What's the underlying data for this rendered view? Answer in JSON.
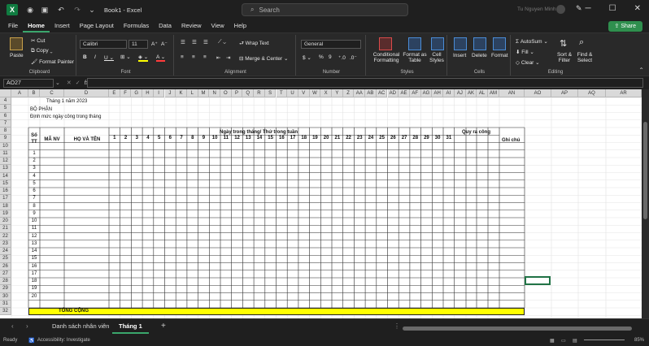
{
  "window": {
    "doc_title": "Book1 - Excel",
    "search_placeholder": "Search",
    "user": "Tu Nguyen Minh"
  },
  "menu": {
    "tabs": [
      "File",
      "Home",
      "Insert",
      "Page Layout",
      "Formulas",
      "Data",
      "Review",
      "View",
      "Help"
    ],
    "active": "Home",
    "share_label": "Share"
  },
  "ribbon": {
    "clipboard": {
      "paste": "Paste",
      "cut": "Cut",
      "copy": "Copy",
      "format_painter": "Format Painter",
      "label": "Clipboard"
    },
    "font": {
      "name": "Calibri",
      "size": "11",
      "label": "Font"
    },
    "alignment": {
      "wrap": "Wrap Text",
      "merge": "Merge & Center",
      "label": "Alignment"
    },
    "number": {
      "format": "General",
      "label": "Number"
    },
    "styles": {
      "conditional": "Conditional Formatting",
      "format_table": "Format as Table",
      "cell_styles": "Cell Styles",
      "label": "Styles"
    },
    "cells": {
      "insert": "Insert",
      "delete": "Delete",
      "format": "Format",
      "label": "Cells"
    },
    "editing": {
      "autosum": "AutoSum",
      "fill": "Fill",
      "clear": "Clear",
      "sort": "Sort & Filter",
      "find": "Find & Select",
      "label": "Editing"
    }
  },
  "formula_bar": {
    "name_box": "AO27",
    "fx": "fx",
    "formula": ""
  },
  "columns": [
    "A",
    "B",
    "C",
    "D",
    "E",
    "F",
    "G",
    "H",
    "I",
    "J",
    "K",
    "L",
    "M",
    "N",
    "O",
    "P",
    "Q",
    "R",
    "S",
    "T",
    "U",
    "V",
    "W",
    "X",
    "Y",
    "Z",
    "AA",
    "AB",
    "AC",
    "AD",
    "AE",
    "AF",
    "AG",
    "AH",
    "AI",
    "AJ",
    "AK",
    "AL",
    "AM",
    "AN",
    "AO",
    "AP",
    "AQ",
    "AR"
  ],
  "sheet": {
    "title_row": "Tháng 1 năm 2023",
    "dept_label": "BỘ PHẬN",
    "norm_label": "Định mức ngày công trong tháng",
    "hdr_stt": "Số TT",
    "hdr_manv": "MÃ NV",
    "hdr_hoten": "HỌ VÀ TÊN",
    "hdr_days": "Ngày trong tháng/ Thứ trong tuần",
    "hdr_quyra": "Quy ra công",
    "hdr_ghichu": "Ghi chú",
    "day_numbers": [
      "1",
      "2",
      "3",
      "4",
      "5",
      "6",
      "7",
      "8",
      "9",
      "10",
      "11",
      "12",
      "13",
      "14",
      "15",
      "16",
      "17",
      "18",
      "19",
      "20",
      "21",
      "22",
      "23",
      "24",
      "25",
      "26",
      "27",
      "28",
      "29",
      "30",
      "31"
    ],
    "stt_values": [
      "1",
      "2",
      "3",
      "4",
      "5",
      "6",
      "7",
      "8",
      "9",
      "10",
      "11",
      "12",
      "13",
      "14",
      "15",
      "16",
      "17",
      "18",
      "19",
      "20"
    ],
    "total_label": "TỔNG CỘNG",
    "row_numbers": [
      "4",
      "5",
      "6",
      "7",
      "8",
      "9",
      "10",
      "11",
      "12",
      "13",
      "14",
      "15",
      "16",
      "17",
      "18",
      "19",
      "20",
      "21",
      "22",
      "23",
      "24",
      "25",
      "26",
      "27",
      "28",
      "29",
      "30",
      "31",
      "32"
    ],
    "highlight_color": "#ffff00"
  },
  "sheet_tabs": {
    "tabs": [
      "Danh sách nhân viên",
      "Tháng 1"
    ],
    "active": "Tháng 1",
    "add": "+"
  },
  "status": {
    "ready": "Ready",
    "accessibility": "Accessibility: Investigate",
    "zoom": "85%"
  }
}
